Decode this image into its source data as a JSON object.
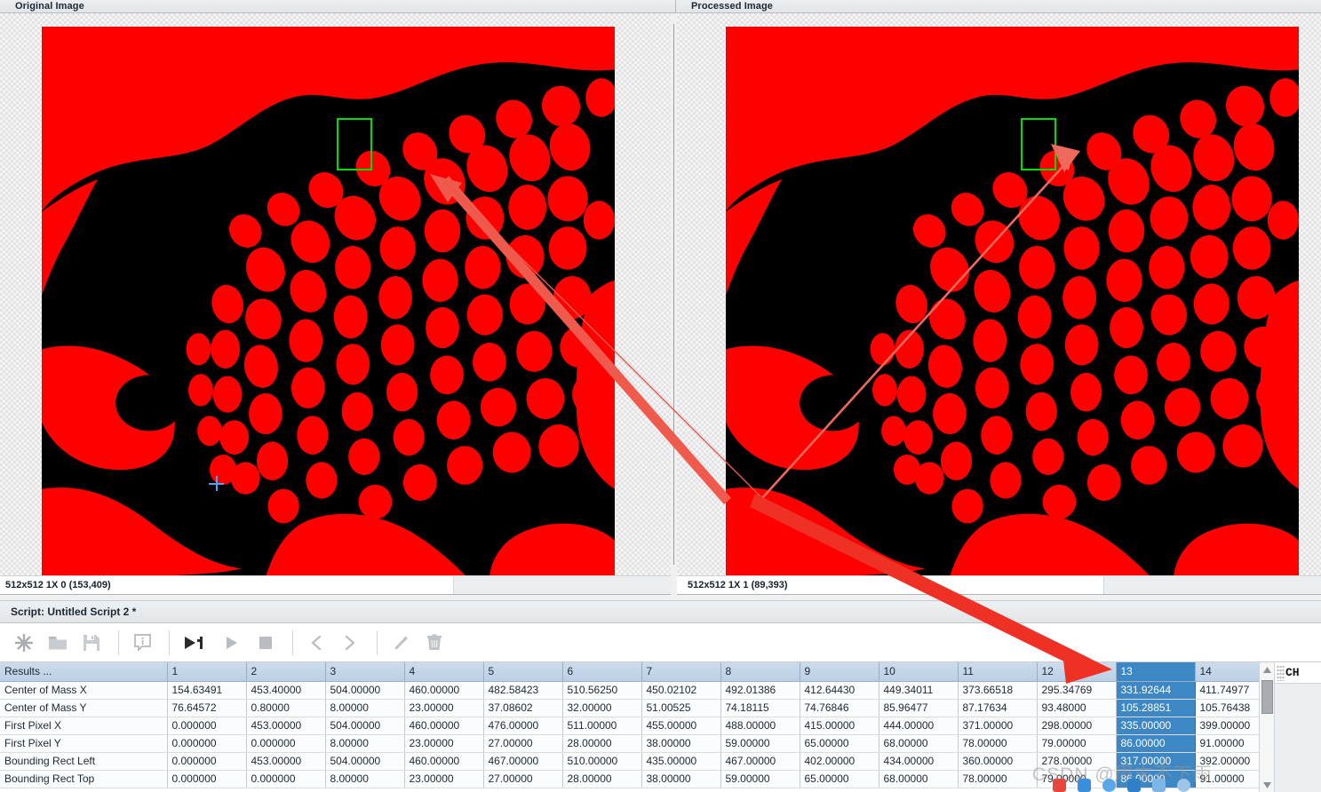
{
  "panels": {
    "left": {
      "title": "Original Image",
      "status": "512x512 1X 0  (153,409)",
      "image_alt": "binary-threshold-red-black-microstructure"
    },
    "right": {
      "title": "Processed Image",
      "status": "512x512 1X 1   (89,393)",
      "image_alt": "binary-threshold-red-black-microstructure-processed"
    }
  },
  "script": {
    "header": "Script: Untitled Script 2 *",
    "toolbar": [
      {
        "name": "new-script-button",
        "icon": "asterisk-icon",
        "label": "New"
      },
      {
        "name": "open-script-button",
        "icon": "folder-icon",
        "label": "Open"
      },
      {
        "name": "save-script-button",
        "icon": "save-icon",
        "label": "Save"
      },
      {
        "name": "comment-button",
        "icon": "info-balloon-icon",
        "label": "Info"
      },
      {
        "name": "run-once-button",
        "icon": "play-one-icon",
        "label": "Run Once"
      },
      {
        "name": "run-button",
        "icon": "play-icon",
        "label": "Run"
      },
      {
        "name": "stop-button",
        "icon": "stop-icon",
        "label": "Stop"
      },
      {
        "name": "step-back-button",
        "icon": "chevron-left-icon",
        "label": "Step Back"
      },
      {
        "name": "step-forward-button",
        "icon": "chevron-right-icon",
        "label": "Step Forward"
      },
      {
        "name": "edit-button",
        "icon": "pencil-icon",
        "label": "Edit"
      },
      {
        "name": "delete-button",
        "icon": "trash-icon",
        "label": "Delete"
      }
    ]
  },
  "results": {
    "label_header": "Results ...",
    "columns": [
      "1",
      "2",
      "3",
      "4",
      "5",
      "6",
      "7",
      "8",
      "9",
      "10",
      "11",
      "12",
      "13",
      "14"
    ],
    "selected_column": "13",
    "rows": [
      {
        "label": "Center of Mass X",
        "values": [
          "154.63491",
          "453.40000",
          "504.00000",
          "460.00000",
          "482.58423",
          "510.56250",
          "450.02102",
          "492.01386",
          "412.64430",
          "449.34011",
          "373.66518",
          "295.34769",
          "331.92644",
          "411.74977"
        ]
      },
      {
        "label": "Center of Mass Y",
        "values": [
          "76.64572",
          "0.80000",
          "8.00000",
          "23.00000",
          "37.08602",
          "32.00000",
          "51.00525",
          "74.18115",
          "74.76846",
          "85.96477",
          "87.17634",
          "93.48000",
          "105.28851",
          "105.76438"
        ]
      },
      {
        "label": "First Pixel X",
        "values": [
          "0.000000",
          "453.00000",
          "504.00000",
          "460.00000",
          "476.00000",
          "511.00000",
          "455.00000",
          "488.00000",
          "415.00000",
          "444.00000",
          "371.00000",
          "298.00000",
          "335.00000",
          "399.00000"
        ]
      },
      {
        "label": "First Pixel Y",
        "values": [
          "0.000000",
          "0.000000",
          "8.00000",
          "23.00000",
          "27.00000",
          "28.00000",
          "38.00000",
          "59.00000",
          "65.00000",
          "68.00000",
          "78.00000",
          "79.00000",
          "86.00000",
          "91.00000"
        ]
      },
      {
        "label": "Bounding Rect Left",
        "values": [
          "0.000000",
          "453.00000",
          "504.00000",
          "460.00000",
          "467.00000",
          "510.00000",
          "435.00000",
          "467.00000",
          "402.00000",
          "434.00000",
          "360.00000",
          "278.00000",
          "317.00000",
          "392.00000"
        ]
      },
      {
        "label": "Bounding Rect Top",
        "values": [
          "0.000000",
          "0.000000",
          "8.00000",
          "23.00000",
          "27.00000",
          "28.00000",
          "38.00000",
          "59.00000",
          "65.00000",
          "68.00000",
          "78.00000",
          "79.00000",
          "86.00000",
          "91.00000"
        ]
      }
    ]
  },
  "side_tab": {
    "label": "CH"
  },
  "scrollbar": {
    "up_icon": "triangle-up-icon",
    "down_icon": "triangle-down-icon"
  },
  "watermark": {
    "text": "CSDN @周末不下雨"
  },
  "annotations": {
    "arrow_color": "#ee3124",
    "thin_arrow_color": "#e8584a",
    "items": [
      {
        "name": "arrow-left-blob-pointer"
      },
      {
        "name": "arrow-right-blob-pointer"
      },
      {
        "name": "arrow-to-column-13"
      }
    ]
  },
  "colors": {
    "blob_red": "#ff0000",
    "background_black": "#000000",
    "selection_blue": "#3d87c4",
    "header_blue": "#c3d5e8",
    "bbox_green": "#00dd00",
    "crosshair_blue": "#4aa3ff"
  }
}
